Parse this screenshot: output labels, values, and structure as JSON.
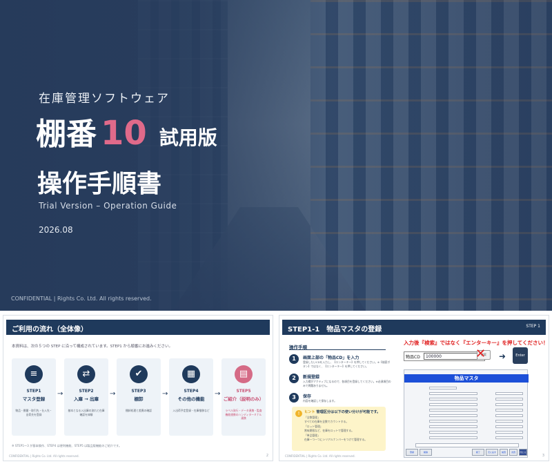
{
  "cover": {
    "subtitle": "在庫管理ソフトウェア",
    "title_main": "棚番",
    "title_number": "10",
    "title_edition": "試用版",
    "doc_title": "操作手順書",
    "english_title": "Trial Version – Operation Guide",
    "date": "2026.08",
    "confidential": "CONFIDENTIAL | Rights Co. Ltd. All rights reserved.",
    "accent_color": "#e06a8a"
  },
  "slide_flow": {
    "header": "ご利用の流れ（全体像）",
    "intro": "本資料は、次の５つの STEP に沿って構成されています。STEP1 から順番にお進みください。",
    "steps": [
      {
        "label": "STEP1",
        "name": "マスタ登録",
        "desc": "物品・棚番・取引先・仕入先・出荷先を登録",
        "icon": "database-icon",
        "glyph": "≡"
      },
      {
        "label": "STEP2",
        "name": "入庫 → 出庫",
        "desc": "基本となる入出庫の流れと在庫確認を体験",
        "icon": "swap-arrows-icon",
        "glyph": "⇄"
      },
      {
        "label": "STEP3",
        "name": "棚卸",
        "desc": "棚卸処理と差異の確認",
        "icon": "clipboard-check-icon",
        "glyph": "✔"
      },
      {
        "label": "STEP4",
        "name": "その他の機能",
        "desc": "入出荷予定登録・在庫推移など",
        "icon": "grid-icon",
        "glyph": "▦"
      },
      {
        "label": "STEP5",
        "name": "ご紹介（説明のみ）",
        "desc": "ラベル発行・データ連携・監査機能連携のハンディターミナル連携",
        "icon": "book-icon",
        "glyph": "▤"
      }
    ],
    "arrow": "→",
    "note": "※ STEP1〜3 が基本操作、STEP4 は便利機能、STEP5 は製品版機能のご紹介です。",
    "footer": "CONFIDENTIAL | Rights Co. Ltd. All rights reserved.",
    "page": "2"
  },
  "slide_step": {
    "header": "STEP1-1　物品マスタの登録",
    "header_right": "STEP 1",
    "proc_title": "操作手順",
    "procs": [
      {
        "num": "1",
        "head": "画面上部の「物品CD」を入力",
        "desc": "登録したいCDを入力し、【エンターキー】を押してください。※【検索ボタン】ではなく、【エンターキー】を押してください。"
      },
      {
        "num": "2",
        "head": "新規登録",
        "desc": "入力欄がアクティブになるので、各項目を登録してください。※必須項目のみで問題ありません。"
      },
      {
        "num": "3",
        "head": "保存",
        "desc": "内容を確認して保存します。"
      }
    ],
    "hint": {
      "prefix": "ヒント",
      "title": "管理区分は以下の使い分けが可能です。",
      "lines": [
        "「全数管理」",
        "すべての在庫を全数でカウントする。",
        "「ロット管理」",
        "賞味期限など、在庫をロットで管理する。",
        "「単品管理」",
        "在庫一つ一つにシリアルナンバーをつけて管理する。"
      ]
    },
    "warning": "入力後『検索』ではなく『エンターキー』を押してください！",
    "code_label": "物品CD",
    "code_value": "100000",
    "search_btn": "検索",
    "enter_key": "Enter",
    "form_title": "物品マスタ",
    "form_buttons": [
      "登録",
      "削除",
      "終了",
      "元に戻す",
      "前頁",
      "次頁",
      "閉じる"
    ],
    "footer": "CONFIDENTIAL | Rights Co. Ltd. All rights reserved.",
    "page": "3"
  }
}
